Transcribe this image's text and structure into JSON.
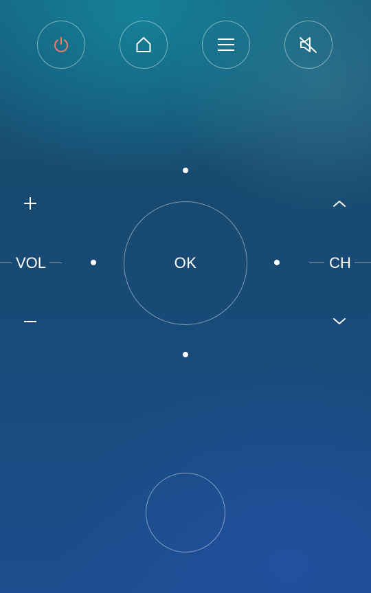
{
  "top_buttons": {
    "power": {
      "icon": "power-icon",
      "color": "#f07a6e"
    },
    "home": {
      "icon": "home-icon"
    },
    "menu": {
      "icon": "menu-icon"
    },
    "mute": {
      "icon": "mute-icon"
    }
  },
  "dpad": {
    "ok_label": "OK"
  },
  "volume": {
    "label": "VOL",
    "up_icon": "plus-icon",
    "down_icon": "minus-icon"
  },
  "channel": {
    "label": "CH",
    "up_icon": "chevron-up-icon",
    "down_icon": "chevron-down-icon"
  },
  "colors": {
    "accent_power": "#f07a6e",
    "foreground": "#ffffff"
  }
}
